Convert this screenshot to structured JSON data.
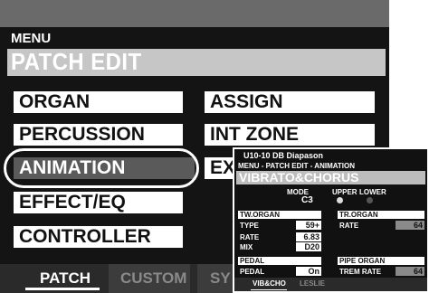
{
  "menu_label": "MENU",
  "title": "PATCH EDIT",
  "buttons": [
    {
      "label": "ORGAN"
    },
    {
      "label": "PERCUSSION"
    },
    {
      "label": "ANIMATION"
    },
    {
      "label": "EFFECT/EQ"
    },
    {
      "label": "CONTROLLER"
    },
    {
      "label": "ASSIGN"
    },
    {
      "label": "INT ZONE"
    },
    {
      "label": "EX"
    }
  ],
  "selected_button": "ANIMATION",
  "tabs": [
    {
      "label": "PATCH",
      "active": true
    },
    {
      "label": "CUSTOM",
      "active": false
    },
    {
      "label": "SY",
      "active": false
    }
  ],
  "inset": {
    "patch": "U10-10 DB Diapason",
    "breadcrumb": "MENU - PATCH EDIT - ANIMATION",
    "title": "VIBRATO&CHORUS",
    "mode_header": "MODE",
    "upper_header": "UPPER",
    "lower_header": "LOWER",
    "mode_value": "C3",
    "upper_on": true,
    "lower_on": false,
    "tw_organ": {
      "header": "TW.ORGAN",
      "type_label": "TYPE",
      "type_value": "59+",
      "rate_label": "RATE",
      "rate_value": "6.83",
      "mix_label": "MIX",
      "mix_value": "D20"
    },
    "tr_organ": {
      "header": "TR.ORGAN",
      "rate_label": "RATE",
      "rate_value": "64"
    },
    "pedal": {
      "header": "PEDAL",
      "pedal_label": "PEDAL",
      "pedal_value": "On"
    },
    "pipe_organ": {
      "header": "PIPE ORGAN",
      "trem_label": "TREM RATE",
      "trem_value": "64"
    },
    "tabs": [
      {
        "label": "VIB&CHO",
        "active": true
      },
      {
        "label": "LESLIE",
        "active": false
      }
    ]
  },
  "colors": {
    "screen_bg": "#141414",
    "button_bg": "#ffffff",
    "button_selected_bg": "#5a5a5a",
    "title_bar": "#c6c6c6"
  }
}
